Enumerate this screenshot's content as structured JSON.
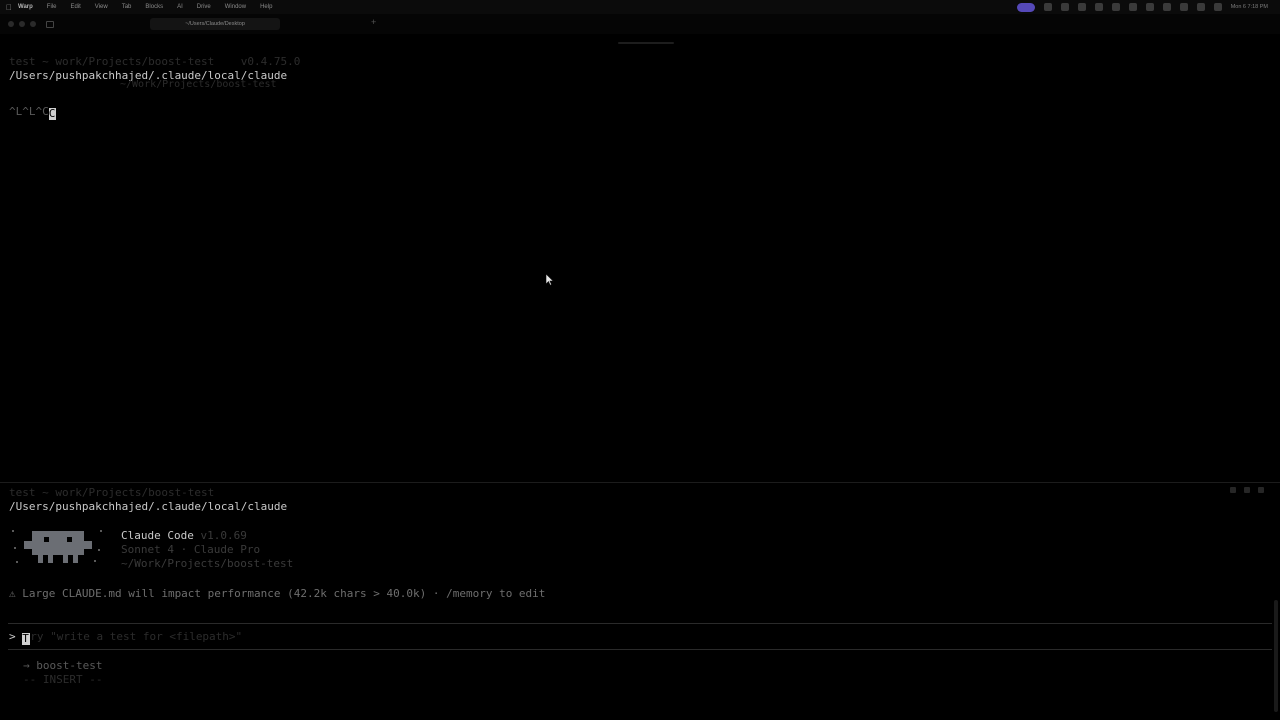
{
  "menubar": {
    "apple_icon": "apple-icon",
    "app_name": "Warp",
    "menus": [
      "File",
      "Edit",
      "View",
      "Tab",
      "Blocks",
      "AI",
      "Drive",
      "Window",
      "Help"
    ],
    "clock": "Mon 6 7:18 PM"
  },
  "tabs": {
    "active_label": "~/Users/Claude/Desktop",
    "inactive_label": "",
    "new_tab": "+"
  },
  "top_pane": {
    "prompt_line": "test ~ work/Projects/boost-test    v0.4.75.0",
    "path": "/Users/pushpakchhajed/.claude/local/claude",
    "faded_line": "~/Work/Projects/boost-test",
    "ctrl_chars": "^L^L^C",
    "cursor_char": "C"
  },
  "bottom_pane": {
    "prompt_line": "test ~ work/Projects/boost-test",
    "path": "/Users/pushpakchhajed/.claude/local/claude",
    "product_name": "Claude Code",
    "version": "v1.0.69",
    "model_line": "Sonnet 4 · Claude Pro",
    "cwd": "~/Work/Projects/boost-test",
    "warning": "⚠ Large CLAUDE.md will impact performance (42.2k chars > 40.0k) · /memory to edit",
    "input_prefix": ">",
    "input_cursor_char": "T",
    "input_placeholder": "ry \"write a test for <filepath>\"",
    "branch_line": "→ boost-test",
    "mode_line": "-- INSERT --"
  },
  "colors": {
    "background": "#000000",
    "text": "#c9c9c9",
    "dim_text": "#3a3a3a",
    "accent": "#5549b8",
    "logo": "#6b6e74"
  }
}
